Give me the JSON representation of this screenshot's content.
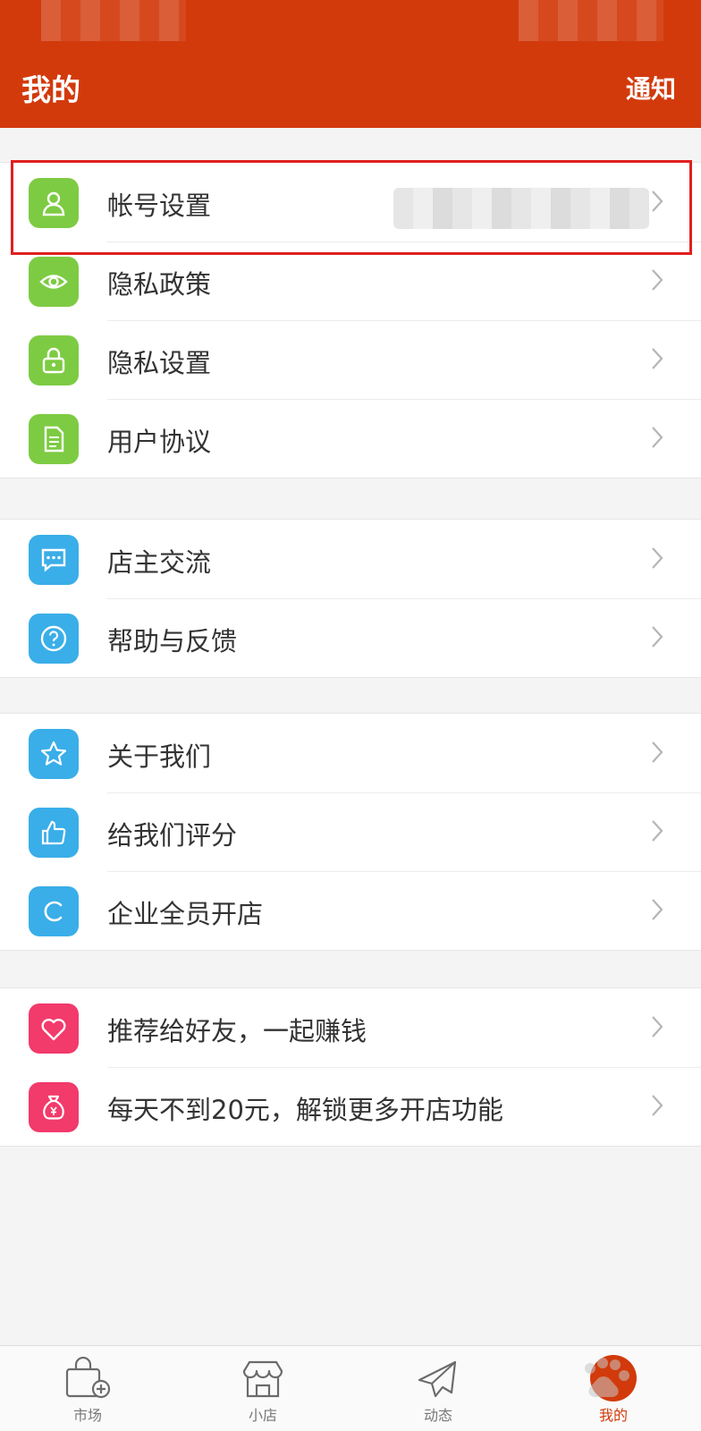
{
  "header": {
    "title": "我的",
    "notify_label": "通知",
    "color": "#d23a0c"
  },
  "groups": [
    {
      "items": [
        {
          "label": "帐号设置",
          "icon": "user-icon",
          "icon_color": "#7dcb43",
          "value_blurred": true
        },
        {
          "label": "隐私政策",
          "icon": "eye-icon",
          "icon_color": "#7dcb43"
        },
        {
          "label": "隐私设置",
          "icon": "lock-icon",
          "icon_color": "#7dcb43"
        },
        {
          "label": "用户协议",
          "icon": "document-icon",
          "icon_color": "#7dcb43"
        }
      ]
    },
    {
      "items": [
        {
          "label": "店主交流",
          "icon": "chat-icon",
          "icon_color": "#3aaee8"
        },
        {
          "label": "帮助与反馈",
          "icon": "help-icon",
          "icon_color": "#3aaee8"
        }
      ]
    },
    {
      "items": [
        {
          "label": "关于我们",
          "icon": "star-icon",
          "icon_color": "#3aaee8"
        },
        {
          "label": "给我们评分",
          "icon": "thumbs-up-icon",
          "icon_color": "#3aaee8"
        },
        {
          "label": "企业全员开店",
          "icon": "c-letter-icon",
          "icon_color": "#3aaee8"
        }
      ]
    },
    {
      "items": [
        {
          "label": "推荐给好友，一起赚钱",
          "icon": "heart-icon",
          "icon_color": "#f23a6b"
        },
        {
          "label": "每天不到20元，解锁更多开店功能",
          "icon": "money-bag-icon",
          "icon_color": "#f23a6b"
        }
      ]
    }
  ],
  "tabbar": {
    "tabs": [
      {
        "label": "市场",
        "icon": "market-bag-icon"
      },
      {
        "label": "小店",
        "icon": "shop-icon"
      },
      {
        "label": "动态",
        "icon": "paper-plane-icon"
      },
      {
        "label": "我的",
        "icon": "profile-icon",
        "active": true
      }
    ]
  },
  "highlight_color": "#e02020"
}
